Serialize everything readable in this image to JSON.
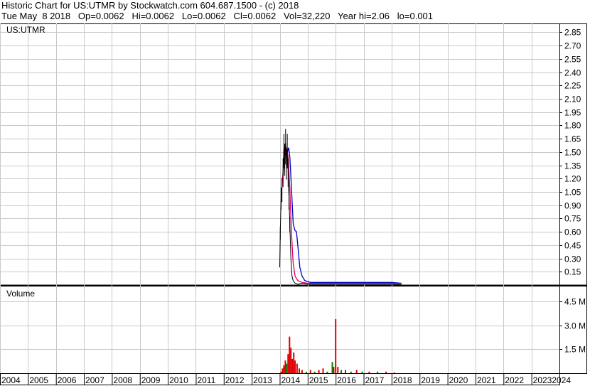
{
  "header": {
    "line1": "Historic Chart for US:UTMR by Stockwatch.com 604.687.1500 - (c) 2018",
    "line2": "Tue May  8 2018   Op=0.0062   Hi=0.0062   Lo=0.0062   Cl=0.0062   Vol=32,220   Year hi=2.06   lo=0.001"
  },
  "colors": {
    "price": "#000000",
    "ma_short": "#e0006a",
    "ma_long": "#0000c0",
    "volume_up": "#008000",
    "volume_down": "#dd0000",
    "grid": "#c8c8c8"
  },
  "chart_data": [
    {
      "type": "line",
      "label": "US:UTMR",
      "ylim": [
        0,
        2.95
      ],
      "ticks": [
        "2.85",
        "2.70",
        "2.55",
        "2.40",
        "2.25",
        "2.10",
        "1.95",
        "1.80",
        "1.65",
        "1.50",
        "1.35",
        "1.20",
        "1.05",
        "0.90",
        "0.75",
        "0.60",
        "0.45",
        "0.30",
        "0.15"
      ],
      "tick_values": [
        2.85,
        2.7,
        2.55,
        2.4,
        2.25,
        2.1,
        1.95,
        1.8,
        1.65,
        1.5,
        1.35,
        1.2,
        1.05,
        0.9,
        0.75,
        0.6,
        0.45,
        0.3,
        0.15
      ],
      "series": [
        {
          "role": "price",
          "x": [
            2014.0,
            2014.02,
            2014.05,
            2014.08,
            2014.12,
            2014.15,
            2014.18,
            2014.21,
            2014.24,
            2014.27,
            2014.3,
            2014.33,
            2014.36,
            2014.4,
            2014.44,
            2014.48,
            2014.55,
            2014.65,
            2014.8,
            2015.0,
            2015.3,
            2015.6,
            2016.0,
            2016.5,
            2017.0,
            2017.5,
            2018.0,
            2018.35
          ],
          "y": [
            0.2,
            0.6,
            1.0,
            1.1,
            1.3,
            1.55,
            1.45,
            1.6,
            1.4,
            1.55,
            1.3,
            1.0,
            0.7,
            0.3,
            0.1,
            0.05,
            0.02,
            0.01,
            0.02,
            0.01,
            0.01,
            0.01,
            0.01,
            0.01,
            0.01,
            0.01,
            0.01,
            0.006
          ]
        },
        {
          "role": "ma_short",
          "x": [
            2014.05,
            2014.12,
            2014.18,
            2014.24,
            2014.3,
            2014.36,
            2014.42,
            2014.48,
            2014.55,
            2014.65,
            2014.8,
            2015.0,
            2015.3,
            2015.6,
            2016.0,
            2016.5,
            2017.0,
            2017.5,
            2018.0,
            2018.35
          ],
          "y": [
            1.0,
            1.25,
            1.45,
            1.55,
            1.45,
            1.1,
            0.6,
            0.25,
            0.1,
            0.05,
            0.03,
            0.02,
            0.02,
            0.02,
            0.02,
            0.02,
            0.02,
            0.02,
            0.02,
            0.02
          ]
        },
        {
          "role": "ma_long",
          "x": [
            2014.28,
            2014.32,
            2014.36,
            2014.42,
            2014.48,
            2014.54,
            2014.6,
            2014.66,
            2014.72,
            2014.8,
            2014.9,
            2015.1,
            2015.4,
            2015.8,
            2016.2,
            2016.6,
            2017.0,
            2017.5,
            2018.0,
            2018.35
          ],
          "y": [
            1.5,
            1.55,
            1.45,
            1.1,
            0.7,
            0.62,
            0.6,
            0.4,
            0.2,
            0.1,
            0.05,
            0.03,
            0.03,
            0.03,
            0.03,
            0.03,
            0.03,
            0.03,
            0.03,
            0.02
          ]
        }
      ]
    },
    {
      "type": "bar",
      "label": "Volume",
      "ylim": [
        0,
        5.5
      ],
      "ticks": [
        "4.5 M",
        "3.0 M",
        "1.5 M"
      ],
      "tick_values": [
        4.5,
        3.0,
        1.5
      ],
      "bars": [
        {
          "x": 2014.05,
          "v": 0.1,
          "c": "down"
        },
        {
          "x": 2014.1,
          "v": 0.3,
          "c": "down"
        },
        {
          "x": 2014.15,
          "v": 0.5,
          "c": "down"
        },
        {
          "x": 2014.2,
          "v": 0.8,
          "c": "down"
        },
        {
          "x": 2014.25,
          "v": 0.6,
          "c": "up"
        },
        {
          "x": 2014.3,
          "v": 1.2,
          "c": "down"
        },
        {
          "x": 2014.35,
          "v": 2.3,
          "c": "down"
        },
        {
          "x": 2014.4,
          "v": 1.6,
          "c": "down"
        },
        {
          "x": 2014.45,
          "v": 0.9,
          "c": "down"
        },
        {
          "x": 2014.5,
          "v": 1.3,
          "c": "down"
        },
        {
          "x": 2014.55,
          "v": 0.8,
          "c": "down"
        },
        {
          "x": 2014.62,
          "v": 0.6,
          "c": "down"
        },
        {
          "x": 2014.7,
          "v": 0.3,
          "c": "down"
        },
        {
          "x": 2014.8,
          "v": 0.2,
          "c": "down"
        },
        {
          "x": 2014.95,
          "v": 0.1,
          "c": "up"
        },
        {
          "x": 2015.1,
          "v": 0.2,
          "c": "down"
        },
        {
          "x": 2015.25,
          "v": 0.1,
          "c": "up"
        },
        {
          "x": 2015.4,
          "v": 0.2,
          "c": "down"
        },
        {
          "x": 2015.55,
          "v": 0.3,
          "c": "down"
        },
        {
          "x": 2015.7,
          "v": 0.1,
          "c": "up"
        },
        {
          "x": 2015.88,
          "v": 0.7,
          "c": "up"
        },
        {
          "x": 2015.93,
          "v": 0.4,
          "c": "down"
        },
        {
          "x": 2016.0,
          "v": 3.4,
          "c": "down"
        },
        {
          "x": 2016.08,
          "v": 0.4,
          "c": "down"
        },
        {
          "x": 2016.2,
          "v": 0.2,
          "c": "up"
        },
        {
          "x": 2016.35,
          "v": 0.2,
          "c": "down"
        },
        {
          "x": 2016.55,
          "v": 0.1,
          "c": "up"
        },
        {
          "x": 2016.75,
          "v": 0.2,
          "c": "down"
        },
        {
          "x": 2016.95,
          "v": 0.1,
          "c": "up"
        },
        {
          "x": 2017.2,
          "v": 0.1,
          "c": "down"
        },
        {
          "x": 2017.5,
          "v": 0.1,
          "c": "up"
        },
        {
          "x": 2017.8,
          "v": 0.1,
          "c": "down"
        },
        {
          "x": 2018.1,
          "v": 0.05,
          "c": "down"
        }
      ]
    }
  ],
  "x_axis": {
    "years": [
      "2004",
      "2005",
      "2006",
      "2007",
      "2008",
      "2009",
      "2010",
      "2011",
      "2012",
      "2013",
      "2014",
      "2015",
      "2016",
      "2017",
      "2018",
      "2019",
      "2020",
      "2021",
      "2022",
      "20232024"
    ],
    "values": [
      2004,
      2005,
      2006,
      2007,
      2008,
      2009,
      2010,
      2011,
      2012,
      2013,
      2014,
      2015,
      2016,
      2017,
      2018,
      2019,
      2020,
      2021,
      2022,
      2023
    ]
  }
}
